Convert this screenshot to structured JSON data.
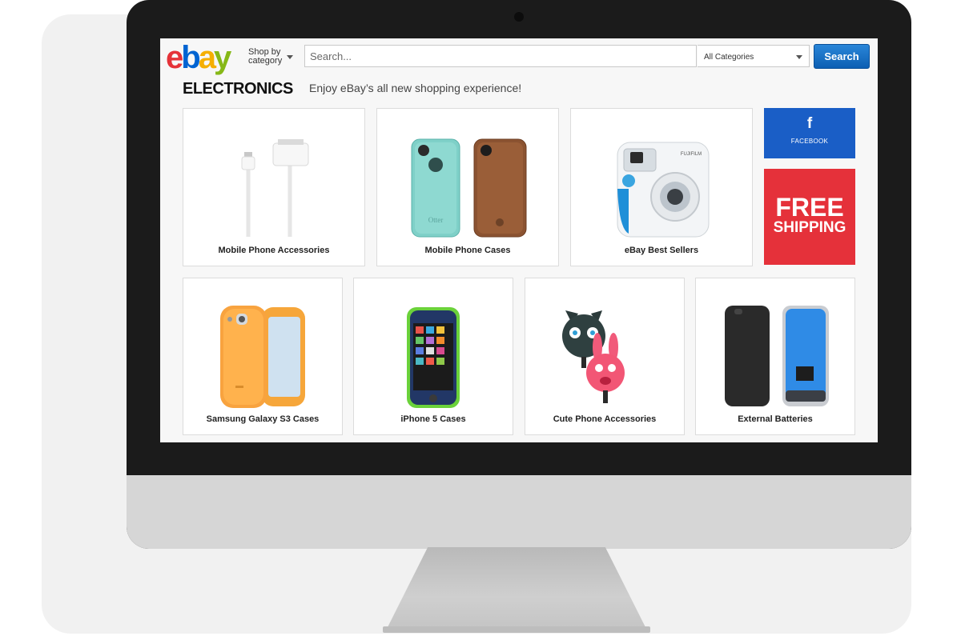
{
  "header": {
    "logo": {
      "e": "e",
      "b": "b",
      "a": "a",
      "y": "y"
    },
    "shop_by": "Shop by",
    "category": "category",
    "search_placeholder": "Search...",
    "category_select": "All Categories",
    "search_button": "Search"
  },
  "page": {
    "heading": "ELECTRONICS",
    "tagline": "Enjoy eBay’s all new shopping experience!"
  },
  "tiles": {
    "accessories": "Mobile Phone Accessories",
    "cases": "Mobile Phone Cases",
    "best_sellers": "eBay Best Sellers",
    "galaxy": "Samsung Galaxy S3 Cases",
    "iphone": "iPhone 5 Cases",
    "cute": "Cute Phone Accessories",
    "batteries": "External Batteries"
  },
  "promos": {
    "facebook_label": "FACEBOOK",
    "facebook_icon": "f",
    "shipping_line1": "FREE",
    "shipping_line2": "SHIPPING"
  },
  "product_art": {
    "otter_brand": "Otter",
    "camera_brand": "FUJIFILM"
  },
  "colors": {
    "logo_red": "#e53238",
    "logo_blue": "#0064d2",
    "logo_yellow": "#f5af02",
    "logo_green": "#86b817",
    "search_blue": "#1a6fc7",
    "facebook_blue": "#1a5ec6",
    "shipping_red": "#e5313a"
  }
}
